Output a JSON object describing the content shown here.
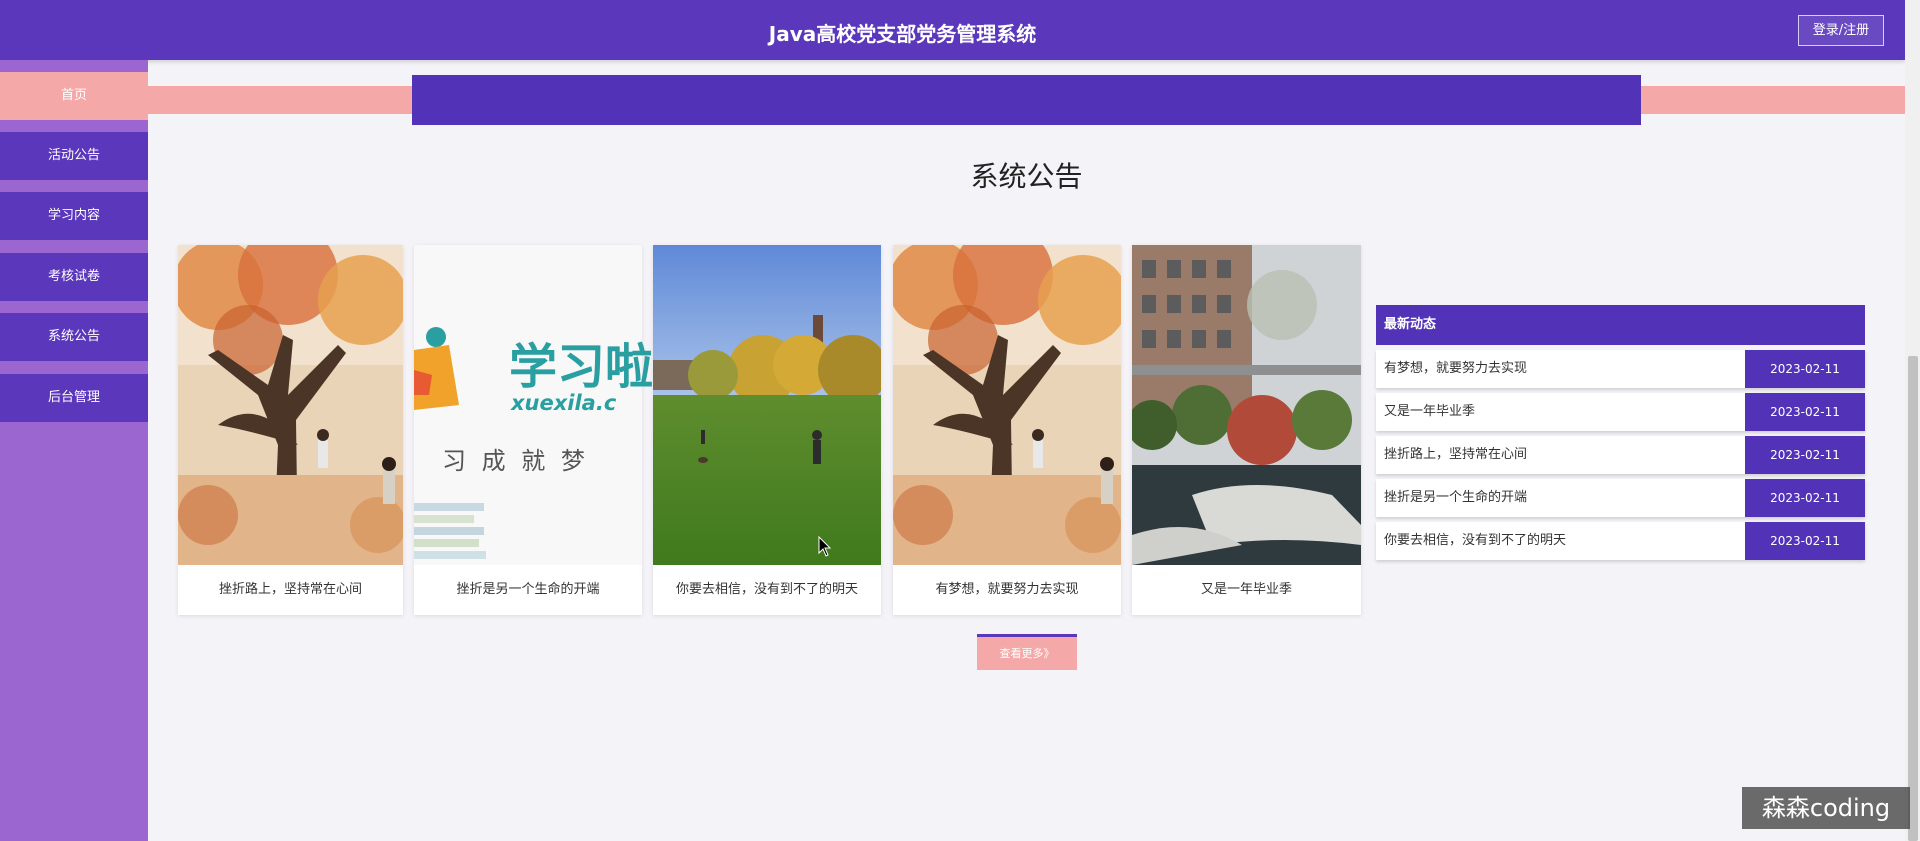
{
  "header": {
    "title": "Java高校党支部党务管理系统",
    "login_label": "登录/注册"
  },
  "sidebar": {
    "items": [
      {
        "label": "首页",
        "active": true
      },
      {
        "label": "活动公告"
      },
      {
        "label": "学习内容"
      },
      {
        "label": "考核试卷"
      },
      {
        "label": "系统公告"
      },
      {
        "label": "后台管理"
      }
    ]
  },
  "main": {
    "section_title": "系统公告",
    "cards": [
      {
        "caption": "挫折路上，坚持常在心间",
        "image": "autumn-tree-illustration"
      },
      {
        "caption": "挫折是另一个生命的开端",
        "image": "xuexila-logo",
        "logo_text": "学习啦",
        "logo_sub": "xuexila.c",
        "slogan": "习 成 就 梦"
      },
      {
        "caption": "你要去相信，没有到不了的明天",
        "image": "campus-lawn-photo"
      },
      {
        "caption": "有梦想，就要努力去实现",
        "image": "autumn-tree-illustration"
      },
      {
        "caption": "又是一年毕业季",
        "image": "campus-courtyard-photo"
      }
    ],
    "more_label": "查看更多》"
  },
  "news": {
    "header": "最新动态",
    "items": [
      {
        "title": "有梦想，就要努力去实现",
        "date": "2023-02-11"
      },
      {
        "title": "又是一年毕业季",
        "date": "2023-02-11"
      },
      {
        "title": "挫折路上，坚持常在心间",
        "date": "2023-02-11"
      },
      {
        "title": "挫折是另一个生命的开端",
        "date": "2023-02-11"
      },
      {
        "title": "你要去相信，没有到不了的明天",
        "date": "2023-02-11"
      }
    ]
  },
  "watermark": "森森coding",
  "colors": {
    "primary": "#5b37bb",
    "accent_pink": "#f4a9a8",
    "sidebar_bg": "#9b66cf",
    "page_bg": "#f4f3f7"
  }
}
